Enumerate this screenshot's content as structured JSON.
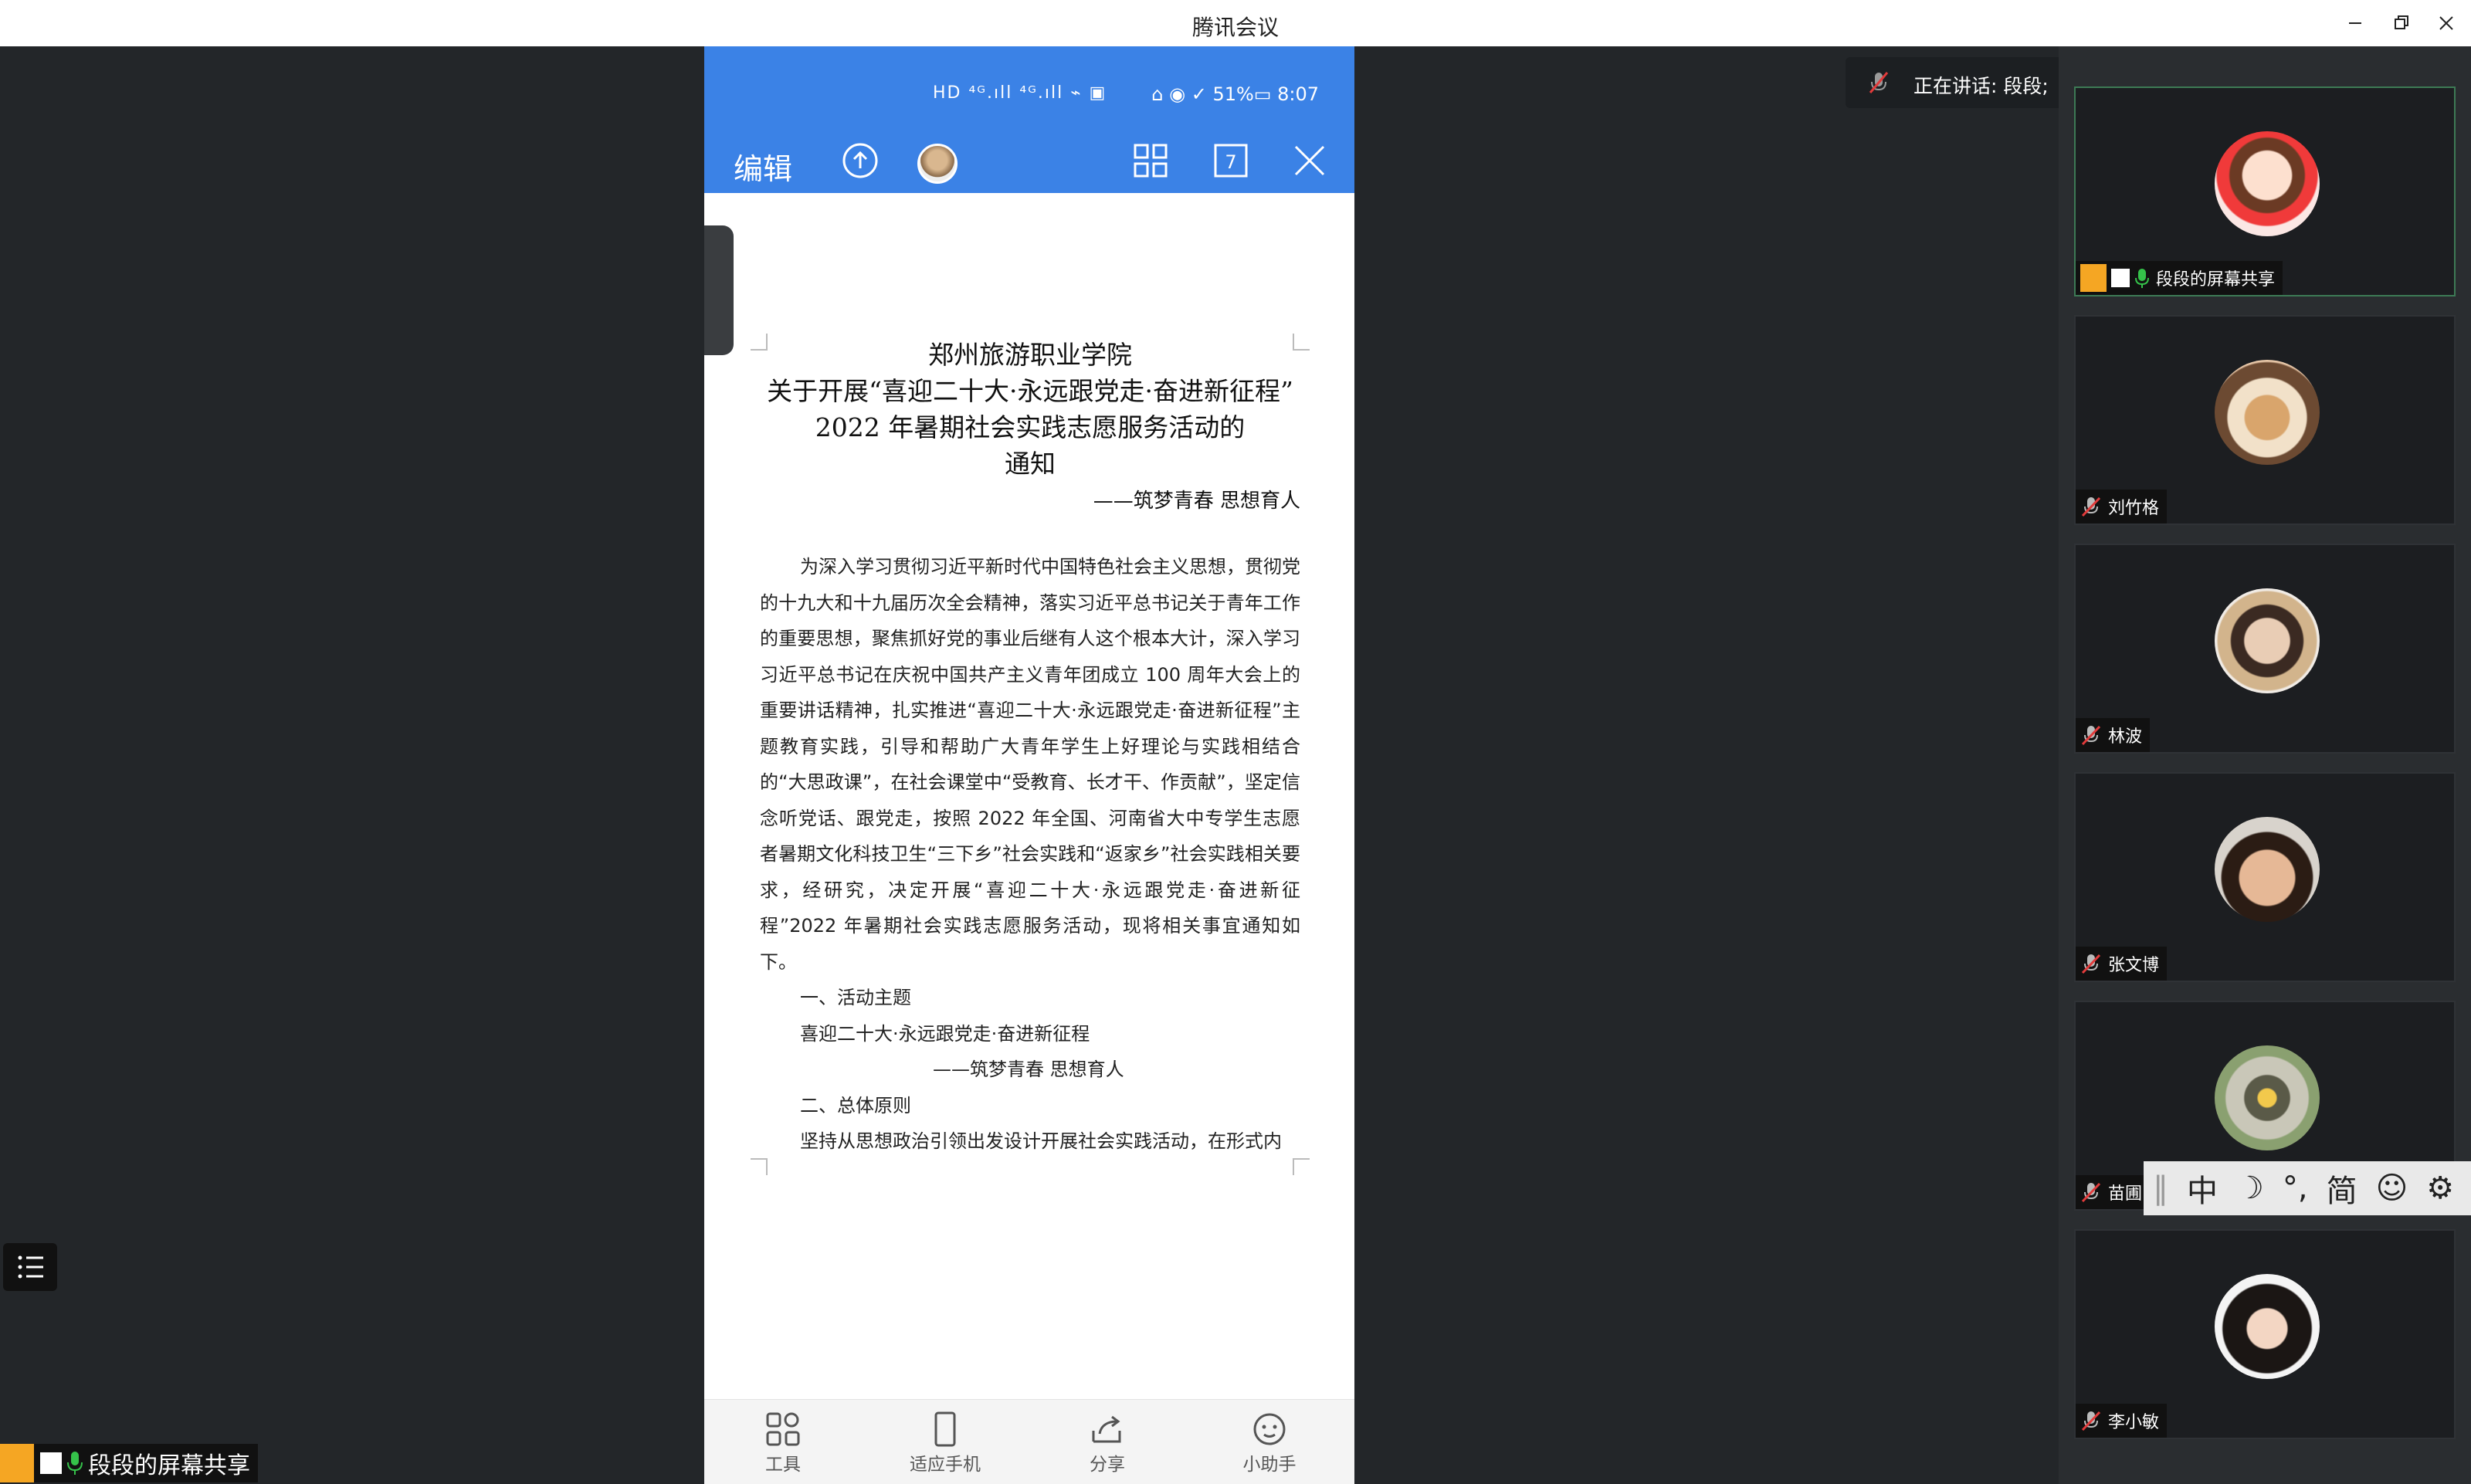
{
  "window": {
    "title": "腾讯会议"
  },
  "phone": {
    "status_icons": "HD ⁴ᴳ.ıll ⁴ᴳ.ıll ⌁ ▣",
    "status_right": "⌂ ◉ ✓ 51%▭ 8:07",
    "toolbar": {
      "edit_label": "编辑",
      "page_badge": "7"
    },
    "document": {
      "title_lines": [
        "郑州旅游职业学院",
        "关于开展“喜迎二十大·永远跟党走·奋进新征程”",
        "2022 年暑期社会实践志愿服务活动的",
        "通知"
      ],
      "subtitle": "——筑梦青春  思想育人",
      "paragraph": "为深入学习贯彻习近平新时代中国特色社会主义思想，贯彻党的十九大和十九届历次全会精神，落实习近平总书记关于青年工作的重要思想，聚焦抓好党的事业后继有人这个根本大计，深入学习习近平总书记在庆祝中国共产主义青年团成立 100 周年大会上的重要讲话精神，扎实推进“喜迎二十大·永远跟党走·奋进新征程”主题教育实践，引导和帮助广大青年学生上好理论与实践相结合的“大思政课”，在社会课堂中“受教育、长才干、作贡献”，坚定信念听党话、跟党走，按照 2022 年全国、河南省大中专学生志愿者暑期文化科技卫生“三下乡”社会实践和“返家乡”社会实践相关要求，经研究，决定开展“喜迎二十大·永远跟党走·奋进新征程”2022 年暑期社会实践志愿服务活动，现将相关事宜通知如下。",
      "section1": "一、活动主题",
      "theme": "喜迎二十大·永远跟党走·奋进新征程",
      "theme_sub": "——筑梦青春  思想育人",
      "section2": "二、总体原则",
      "last_line": "坚持从思想政治引领出发设计开展社会实践活动，在形式内"
    },
    "bottom_bar": [
      "工具",
      "适应手机",
      "分享",
      "小助手"
    ]
  },
  "speaking": {
    "label": "正在讲话: 段段;"
  },
  "participants": [
    {
      "name": "段段的屏幕共享",
      "active": true
    },
    {
      "name": "刘竹格"
    },
    {
      "name": "林波"
    },
    {
      "name": "张文博"
    },
    {
      "name": "苗圃"
    },
    {
      "name": "李小敏"
    }
  ],
  "ime": {
    "items": [
      "中",
      "☽",
      "°,",
      "简",
      "☺",
      "⚙"
    ]
  },
  "bottom_share_label": "段段的屏幕共享",
  "colors": {
    "accent_blue": "#3b82e6",
    "active_green": "#3d7a55",
    "mic_green": "#35c24a",
    "user_orange": "#f5a623"
  }
}
